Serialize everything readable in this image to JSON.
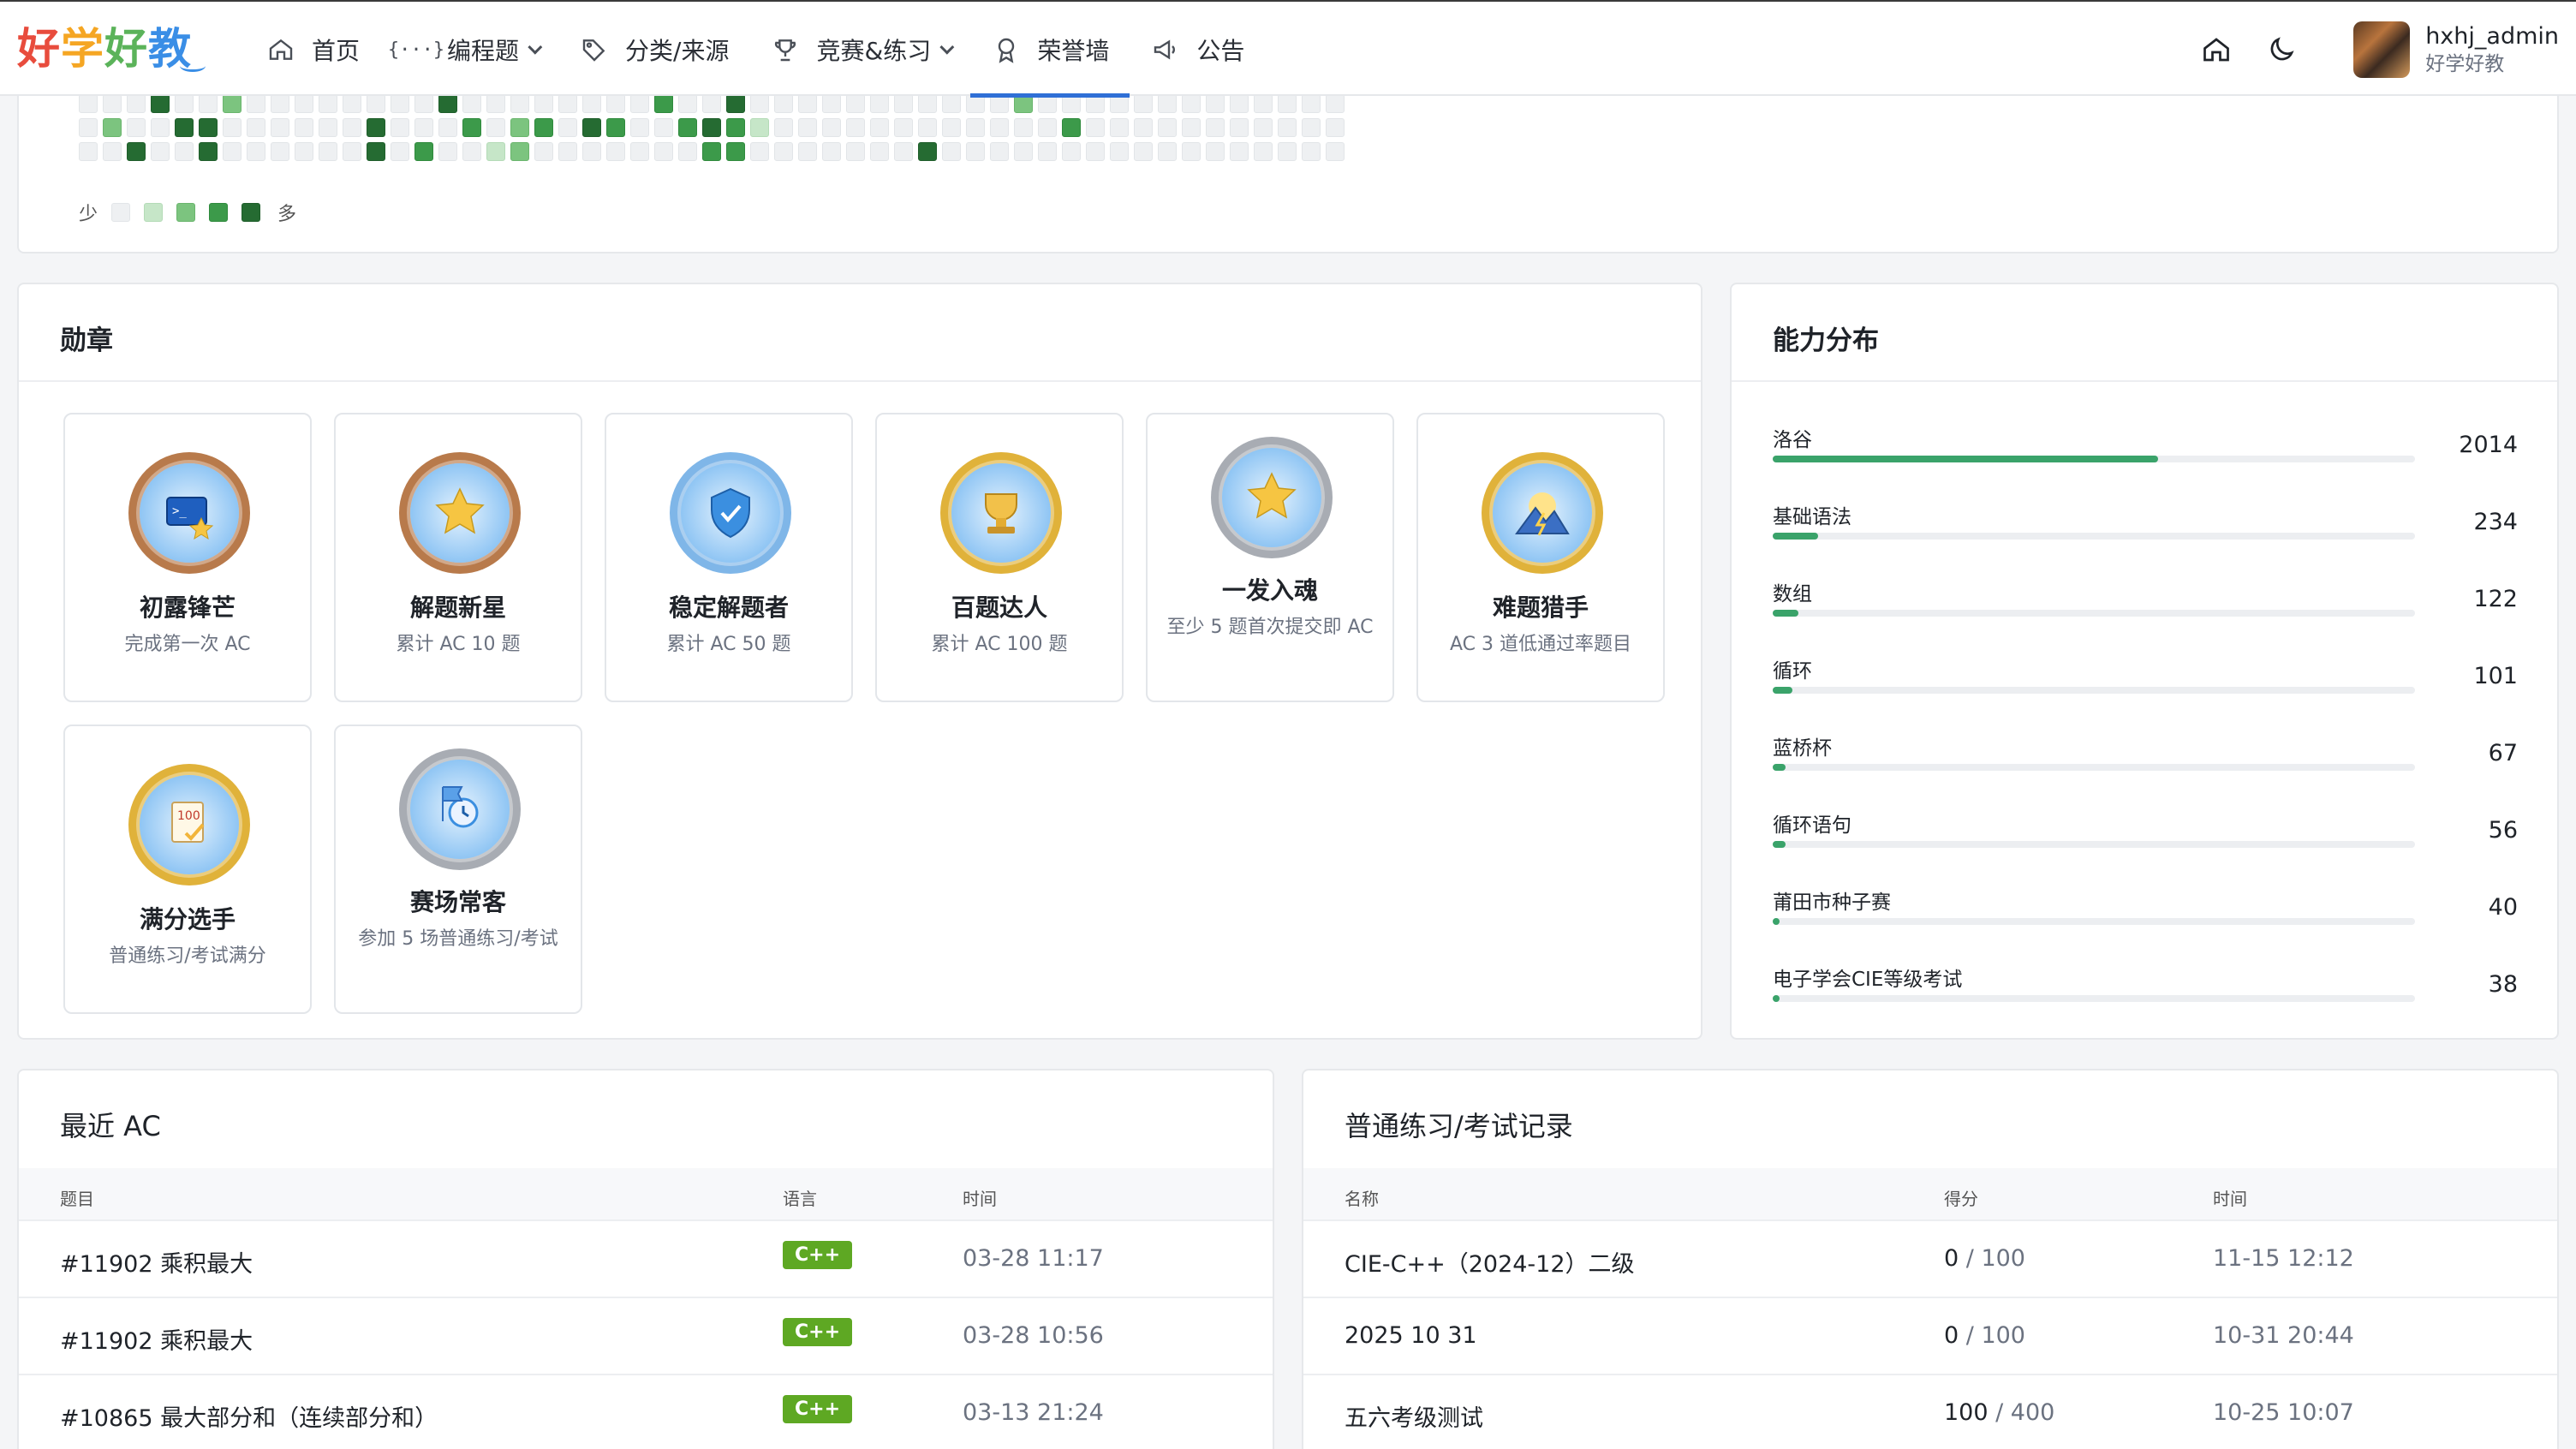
{
  "brand": {
    "logo_chars": [
      "好",
      "学",
      "好",
      "教"
    ]
  },
  "nav": [
    {
      "label": "首页",
      "icon": "home-icon",
      "dropdown": false,
      "active": false
    },
    {
      "label": "编程题",
      "icon": "code-braces-icon",
      "dropdown": true,
      "active": false
    },
    {
      "label": "分类/来源",
      "icon": "tags-icon",
      "dropdown": false,
      "active": false
    },
    {
      "label": "竞赛&练习",
      "icon": "trophy-icon",
      "dropdown": true,
      "active": false
    },
    {
      "label": "荣誉墙",
      "icon": "award-icon",
      "dropdown": false,
      "active": true
    },
    {
      "label": "公告",
      "icon": "megaphone-icon",
      "dropdown": false,
      "active": false
    }
  ],
  "user": {
    "name": "hxhj_admin",
    "subtitle": "好学好教"
  },
  "heatmap": {
    "legend_less": "少",
    "legend_more": "多"
  },
  "badges": {
    "title": "勋章",
    "items": [
      {
        "name": "初露锋芒",
        "desc": "完成第一次 AC",
        "rim": "#b87a4b",
        "icon": "terminal-icon"
      },
      {
        "name": "解题新星",
        "desc": "累计 AC 10 题",
        "rim": "#b87a4b",
        "icon": "star-icon"
      },
      {
        "name": "稳定解题者",
        "desc": "累计 AC 50 题",
        "rim": "#7fb6e8",
        "icon": "shield-check-icon"
      },
      {
        "name": "百题达人",
        "desc": "累计 AC 100 题",
        "rim": "#e0b23a",
        "icon": "trophy-icon"
      },
      {
        "name": "一发入魂",
        "desc": "至少 5 题首次提交即 AC",
        "rim": "#a8acb3",
        "icon": "star-icon"
      },
      {
        "name": "难题猎手",
        "desc": "AC 3 道低通过率题目",
        "rim": "#e0b23a",
        "icon": "mountain-icon"
      },
      {
        "name": "满分选手",
        "desc": "普通练习/考试满分",
        "rim": "#e0b23a",
        "icon": "score-sheet-icon"
      },
      {
        "name": "赛场常客",
        "desc": "参加 5 场普通练习/考试",
        "rim": "#a8acb3",
        "icon": "stopwatch-icon"
      }
    ]
  },
  "ability": {
    "title": "能力分布",
    "max": 2014,
    "items": [
      {
        "label": "洛谷",
        "value": 2014,
        "fill": 0.6
      },
      {
        "label": "基础语法",
        "value": 234,
        "fill": 0.07
      },
      {
        "label": "数组",
        "value": 122,
        "fill": 0.04
      },
      {
        "label": "循环",
        "value": 101,
        "fill": 0.03
      },
      {
        "label": "蓝桥杯",
        "value": 67,
        "fill": 0.02
      },
      {
        "label": "循环语句",
        "value": 56,
        "fill": 0.02
      },
      {
        "label": "莆田市种子赛",
        "value": 40,
        "fill": 0.01
      },
      {
        "label": "电子学会CIE等级考试",
        "value": 38,
        "fill": 0.01
      }
    ]
  },
  "recent_ac": {
    "title": "最近 AC",
    "columns": [
      "题目",
      "语言",
      "时间"
    ],
    "rows": [
      {
        "problem": "#11902 乘积最大",
        "lang": "C++",
        "time": "03-28 11:17"
      },
      {
        "problem": "#11902 乘积最大",
        "lang": "C++",
        "time": "03-28 10:56"
      },
      {
        "problem": "#10865 最大部分和（连续部分和）",
        "lang": "C++",
        "time": "03-13 21:24"
      }
    ]
  },
  "exam_records": {
    "title": "普通练习/考试记录",
    "columns": [
      "名称",
      "得分",
      "时间"
    ],
    "rows": [
      {
        "name": "CIE-C++（2024-12）二级",
        "score": "0",
        "total": " / 100",
        "time": "11-15 12:12"
      },
      {
        "name": "2025 10 31",
        "score": "0",
        "total": " / 100",
        "time": "10-31 20:44"
      },
      {
        "name": "五六考级测试",
        "score": "100",
        "total": " / 400",
        "time": "10-25 10:07"
      }
    ]
  },
  "colors": {
    "accent": "#2f6fd6",
    "bar": "#3aa36a",
    "lang_tag": "#5ea823"
  }
}
